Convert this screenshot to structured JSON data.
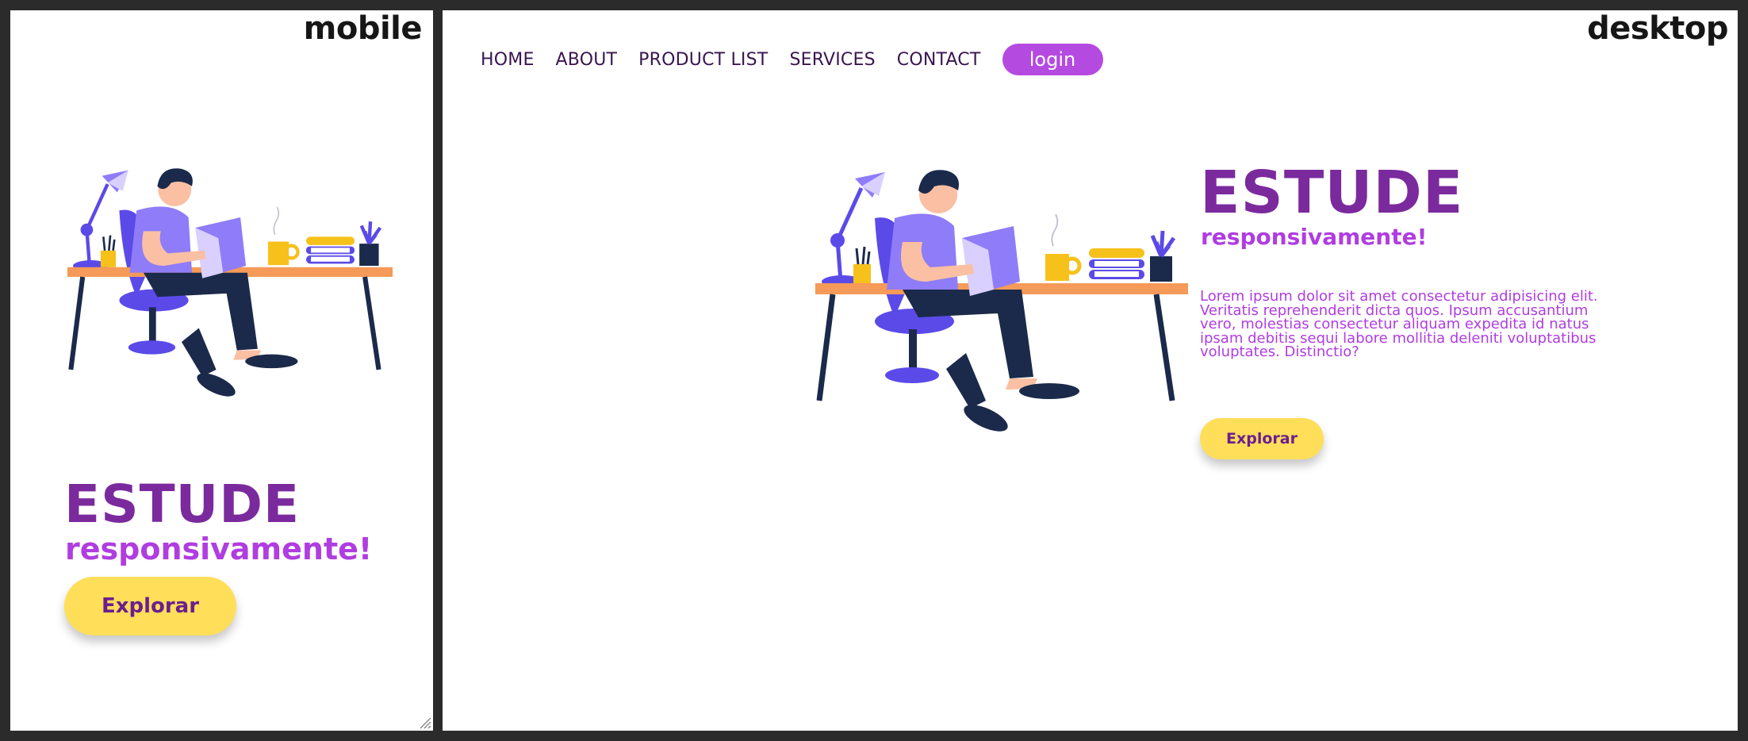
{
  "mobile": {
    "label": "mobile",
    "title": "ESTUDE",
    "subtitle": "responsivamente!",
    "explore_label": "Explorar"
  },
  "desktop": {
    "label": "desktop",
    "nav": {
      "items": [
        {
          "label": "HOME"
        },
        {
          "label": "ABOUT"
        },
        {
          "label": "PRODUCT LIST"
        },
        {
          "label": "SERVICES"
        },
        {
          "label": "CONTACT"
        }
      ],
      "login_label": "login"
    },
    "title": "ESTUDE",
    "subtitle": "responsivamente!",
    "paragraph": "Lorem ipsum dolor sit amet consectetur adipisicing elit. Veritatis reprehenderit dicta quos. Ipsum accusantium vero, molestias consectetur aliquam expedita id natus ipsam debitis sequi labore mollitia deleniti voluptatibus voluptates. Distinctio?",
    "explore_label": "Explorar"
  },
  "colors": {
    "title": "#7b2a9e",
    "accent": "#b03de0",
    "login_bg": "#b54ae0",
    "button_bg": "#ffde59",
    "nav_text": "#3a1550",
    "frame_bg": "#2b2b2b"
  },
  "icons": {
    "illustration": "person-reading-at-desk-illustration",
    "grip": "resize-grip-icon"
  }
}
